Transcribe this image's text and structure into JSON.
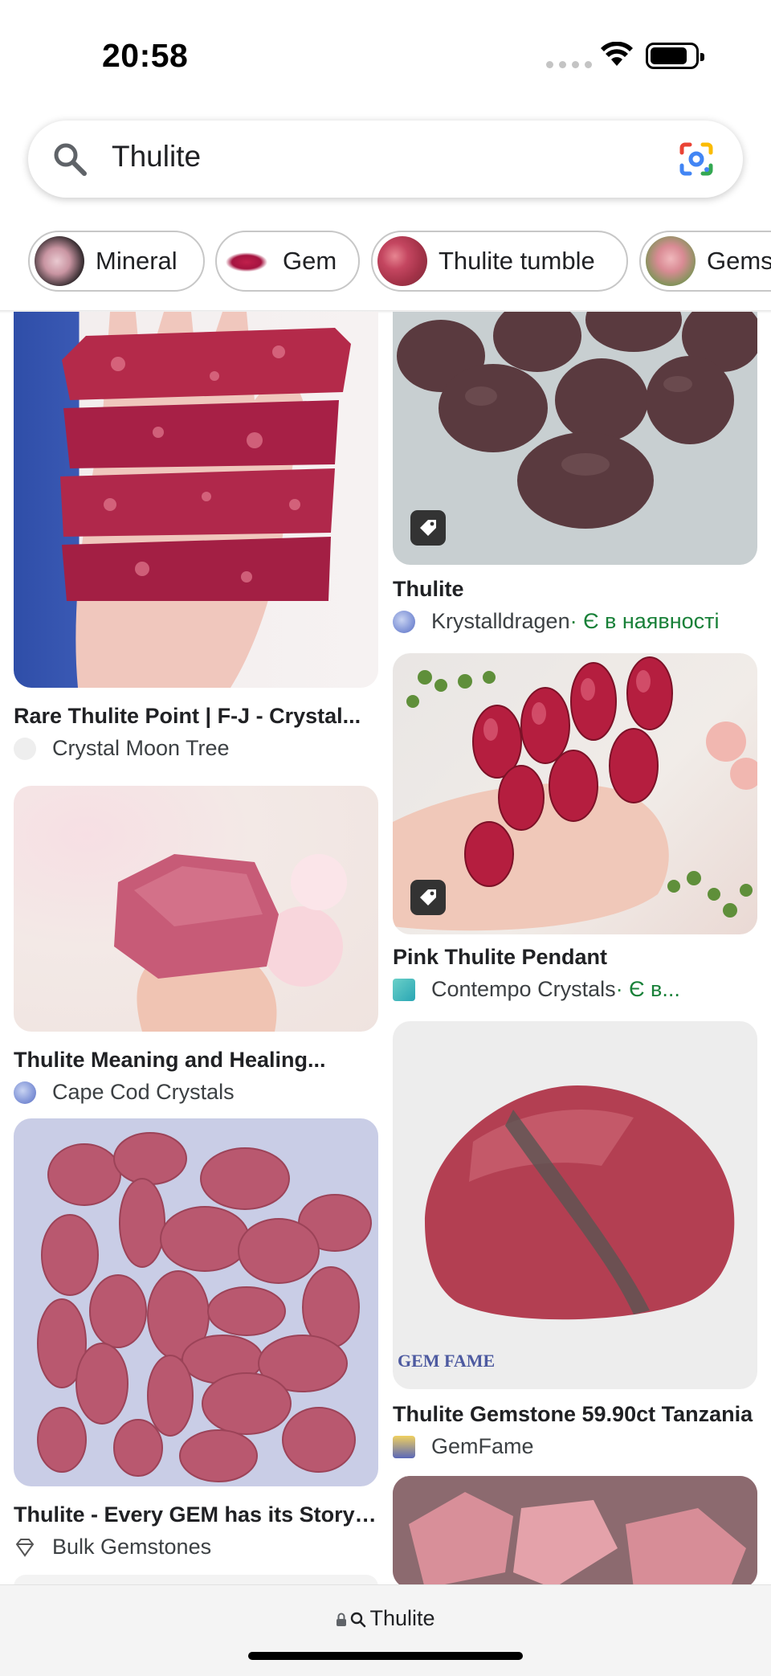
{
  "status_bar": {
    "time": "20:58"
  },
  "search": {
    "query": "Thulite"
  },
  "chips": [
    {
      "label": "Mineral"
    },
    {
      "label": "Gem"
    },
    {
      "label": "Thulite tumble"
    },
    {
      "label": "Gemstone"
    }
  ],
  "results": {
    "left": [
      {
        "title": "Rare Thulite Point | F-J - Crystal...",
        "source": "Crystal Moon Tree"
      },
      {
        "title": "Thulite Meaning and Healing...",
        "source": "Cape Cod Crystals"
      },
      {
        "title": "Thulite - Every GEM has its Story!...",
        "source": "Bulk Gemstones"
      }
    ],
    "right": [
      {
        "title": "Thulite",
        "source": "Krystalldragen",
        "stock": " · Є в наявності"
      },
      {
        "title": "Pink Thulite Pendant",
        "source": "Contempo Crystals",
        "stock": " · Є в..."
      },
      {
        "title": "Thulite Gemstone 59.90ct Tanzania",
        "source": "GemFame",
        "watermark": "GEM FAME"
      }
    ]
  },
  "bottom_bar": {
    "url": "Thulite"
  },
  "colors": {
    "in_stock": "#188038",
    "accent_blue": "#1a73e8"
  }
}
